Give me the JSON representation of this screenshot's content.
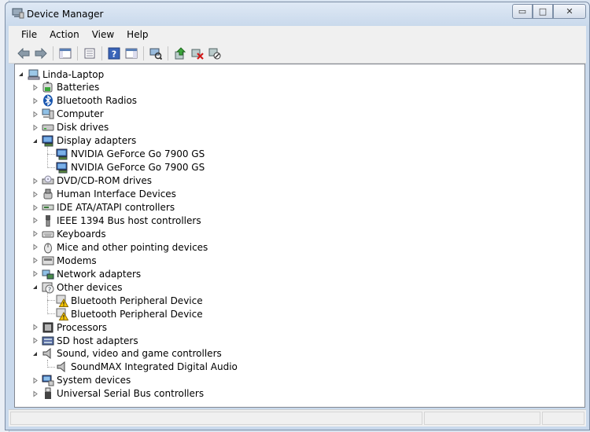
{
  "window": {
    "title": "Device Manager"
  },
  "controls": {
    "minimize": "▭",
    "maximize": "□",
    "close": "✕"
  },
  "menu": [
    "File",
    "Action",
    "View",
    "Help"
  ],
  "toolbar": [
    {
      "icon": "back-arrow-icon"
    },
    {
      "icon": "forward-arrow-icon"
    },
    {
      "icon": "show-hide-console-tree-icon"
    },
    {
      "icon": "properties-icon"
    },
    {
      "icon": "help-icon"
    },
    {
      "icon": "action-pane-icon"
    },
    {
      "icon": "scan-hardware-changes-icon"
    },
    {
      "icon": "update-driver-icon"
    },
    {
      "icon": "uninstall-icon"
    },
    {
      "icon": "disable-device-icon"
    }
  ],
  "tree": {
    "root": "Linda-Laptop",
    "categories": [
      {
        "label": "Batteries",
        "icon": "battery-icon",
        "expanded": false,
        "children": []
      },
      {
        "label": "Bluetooth Radios",
        "icon": "bluetooth-icon",
        "expanded": false,
        "children": []
      },
      {
        "label": "Computer",
        "icon": "computer-icon",
        "expanded": false,
        "children": []
      },
      {
        "label": "Disk drives",
        "icon": "disk-drive-icon",
        "expanded": false,
        "children": []
      },
      {
        "label": "Display adapters",
        "icon": "display-adapter-icon",
        "expanded": true,
        "children": [
          {
            "label": "NVIDIA GeForce Go 7900 GS",
            "icon": "display-adapter-icon"
          },
          {
            "label": "NVIDIA GeForce Go 7900 GS",
            "icon": "display-adapter-icon"
          }
        ]
      },
      {
        "label": "DVD/CD-ROM drives",
        "icon": "dvd-drive-icon",
        "expanded": false,
        "children": []
      },
      {
        "label": "Human Interface Devices",
        "icon": "hid-icon",
        "expanded": false,
        "children": []
      },
      {
        "label": "IDE ATA/ATAPI controllers",
        "icon": "ide-controller-icon",
        "expanded": false,
        "children": []
      },
      {
        "label": "IEEE 1394 Bus host controllers",
        "icon": "firewire-icon",
        "expanded": false,
        "children": []
      },
      {
        "label": "Keyboards",
        "icon": "keyboard-icon",
        "expanded": false,
        "children": []
      },
      {
        "label": "Mice and other pointing devices",
        "icon": "mouse-icon",
        "expanded": false,
        "children": []
      },
      {
        "label": "Modems",
        "icon": "modem-icon",
        "expanded": false,
        "children": []
      },
      {
        "label": "Network adapters",
        "icon": "network-adapter-icon",
        "expanded": false,
        "children": []
      },
      {
        "label": "Other devices",
        "icon": "unknown-device-icon",
        "expanded": true,
        "children": [
          {
            "label": "Bluetooth Peripheral Device",
            "icon": "warning-device-icon"
          },
          {
            "label": "Bluetooth Peripheral Device",
            "icon": "warning-device-icon"
          }
        ]
      },
      {
        "label": "Processors",
        "icon": "processor-icon",
        "expanded": false,
        "children": []
      },
      {
        "label": "SD host adapters",
        "icon": "sd-adapter-icon",
        "expanded": false,
        "children": []
      },
      {
        "label": "Sound, video and game controllers",
        "icon": "speaker-icon",
        "expanded": true,
        "children": [
          {
            "label": "SoundMAX Integrated Digital Audio",
            "icon": "speaker-icon"
          }
        ]
      },
      {
        "label": "System devices",
        "icon": "system-device-icon",
        "expanded": false,
        "children": []
      },
      {
        "label": "Universal Serial Bus controllers",
        "icon": "usb-icon",
        "expanded": false,
        "children": []
      }
    ]
  },
  "colors": {
    "tree_lines": "#a0a0a0",
    "window_frame": "#c9d9ec",
    "warning": "#f5c400"
  }
}
